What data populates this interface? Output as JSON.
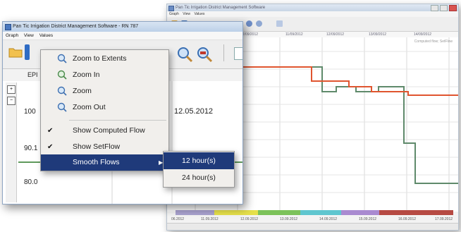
{
  "back_window": {
    "title": "Pan Tic Irrigation District Management Software",
    "menu": [
      "Graph",
      "View",
      "Values"
    ],
    "timebar_labels": [
      "12/09/2012",
      "11/09/2012",
      "12/09/2012",
      "13/09/2012",
      "14/09/2012"
    ],
    "legend_note": "Computed flow; SetFlow",
    "bottom_axis_labels": [
      "06.2012",
      "11.09.2012",
      "12.09.2012",
      "13.09.2012",
      "14.09.2012",
      "15.09.2012",
      "16.09.2012",
      "17.09.2012"
    ],
    "time_strip_colors": [
      "#a9a2cf",
      "#e6e04a",
      "#7cc25a",
      "#5fc6cf",
      "#a98ad0",
      "#b64a43"
    ],
    "series_colors": {
      "computed_flow": "#5f8a6b",
      "setflow": "#e0552f"
    }
  },
  "front_window": {
    "title": "Pan Tic Irrigation District Management Software - RN 787",
    "menu": [
      "Graph",
      "View",
      "Values"
    ],
    "tab_label": "EPI",
    "y_labels": [
      "100",
      "90.1",
      "80.0"
    ],
    "date_label": "12.05.2012",
    "gutter_buttons": [
      "+",
      "−"
    ]
  },
  "context_menu": {
    "items": [
      {
        "label": "Zoom to Extents",
        "icon": "zoom-extents-icon",
        "checked": false
      },
      {
        "label": "Zoom In",
        "icon": "zoom-in-icon",
        "checked": false
      },
      {
        "label": "Zoom",
        "icon": "zoom-icon",
        "checked": false
      },
      {
        "label": "Zoom Out",
        "icon": "zoom-out-icon",
        "checked": false
      },
      {
        "label": "Show Computed Flow",
        "checked": true
      },
      {
        "label": "Show SetFlow",
        "checked": true
      },
      {
        "label": "Smooth Flows",
        "has_submenu": true,
        "highlighted": true
      }
    ],
    "check_glyph": "✔",
    "submenu_arrow": "▶",
    "submenu": [
      {
        "label": "12 hour(s)",
        "highlighted": true
      },
      {
        "label": "24 hour(s)",
        "highlighted": false
      }
    ],
    "highlight_color": "#1f3a7a"
  }
}
